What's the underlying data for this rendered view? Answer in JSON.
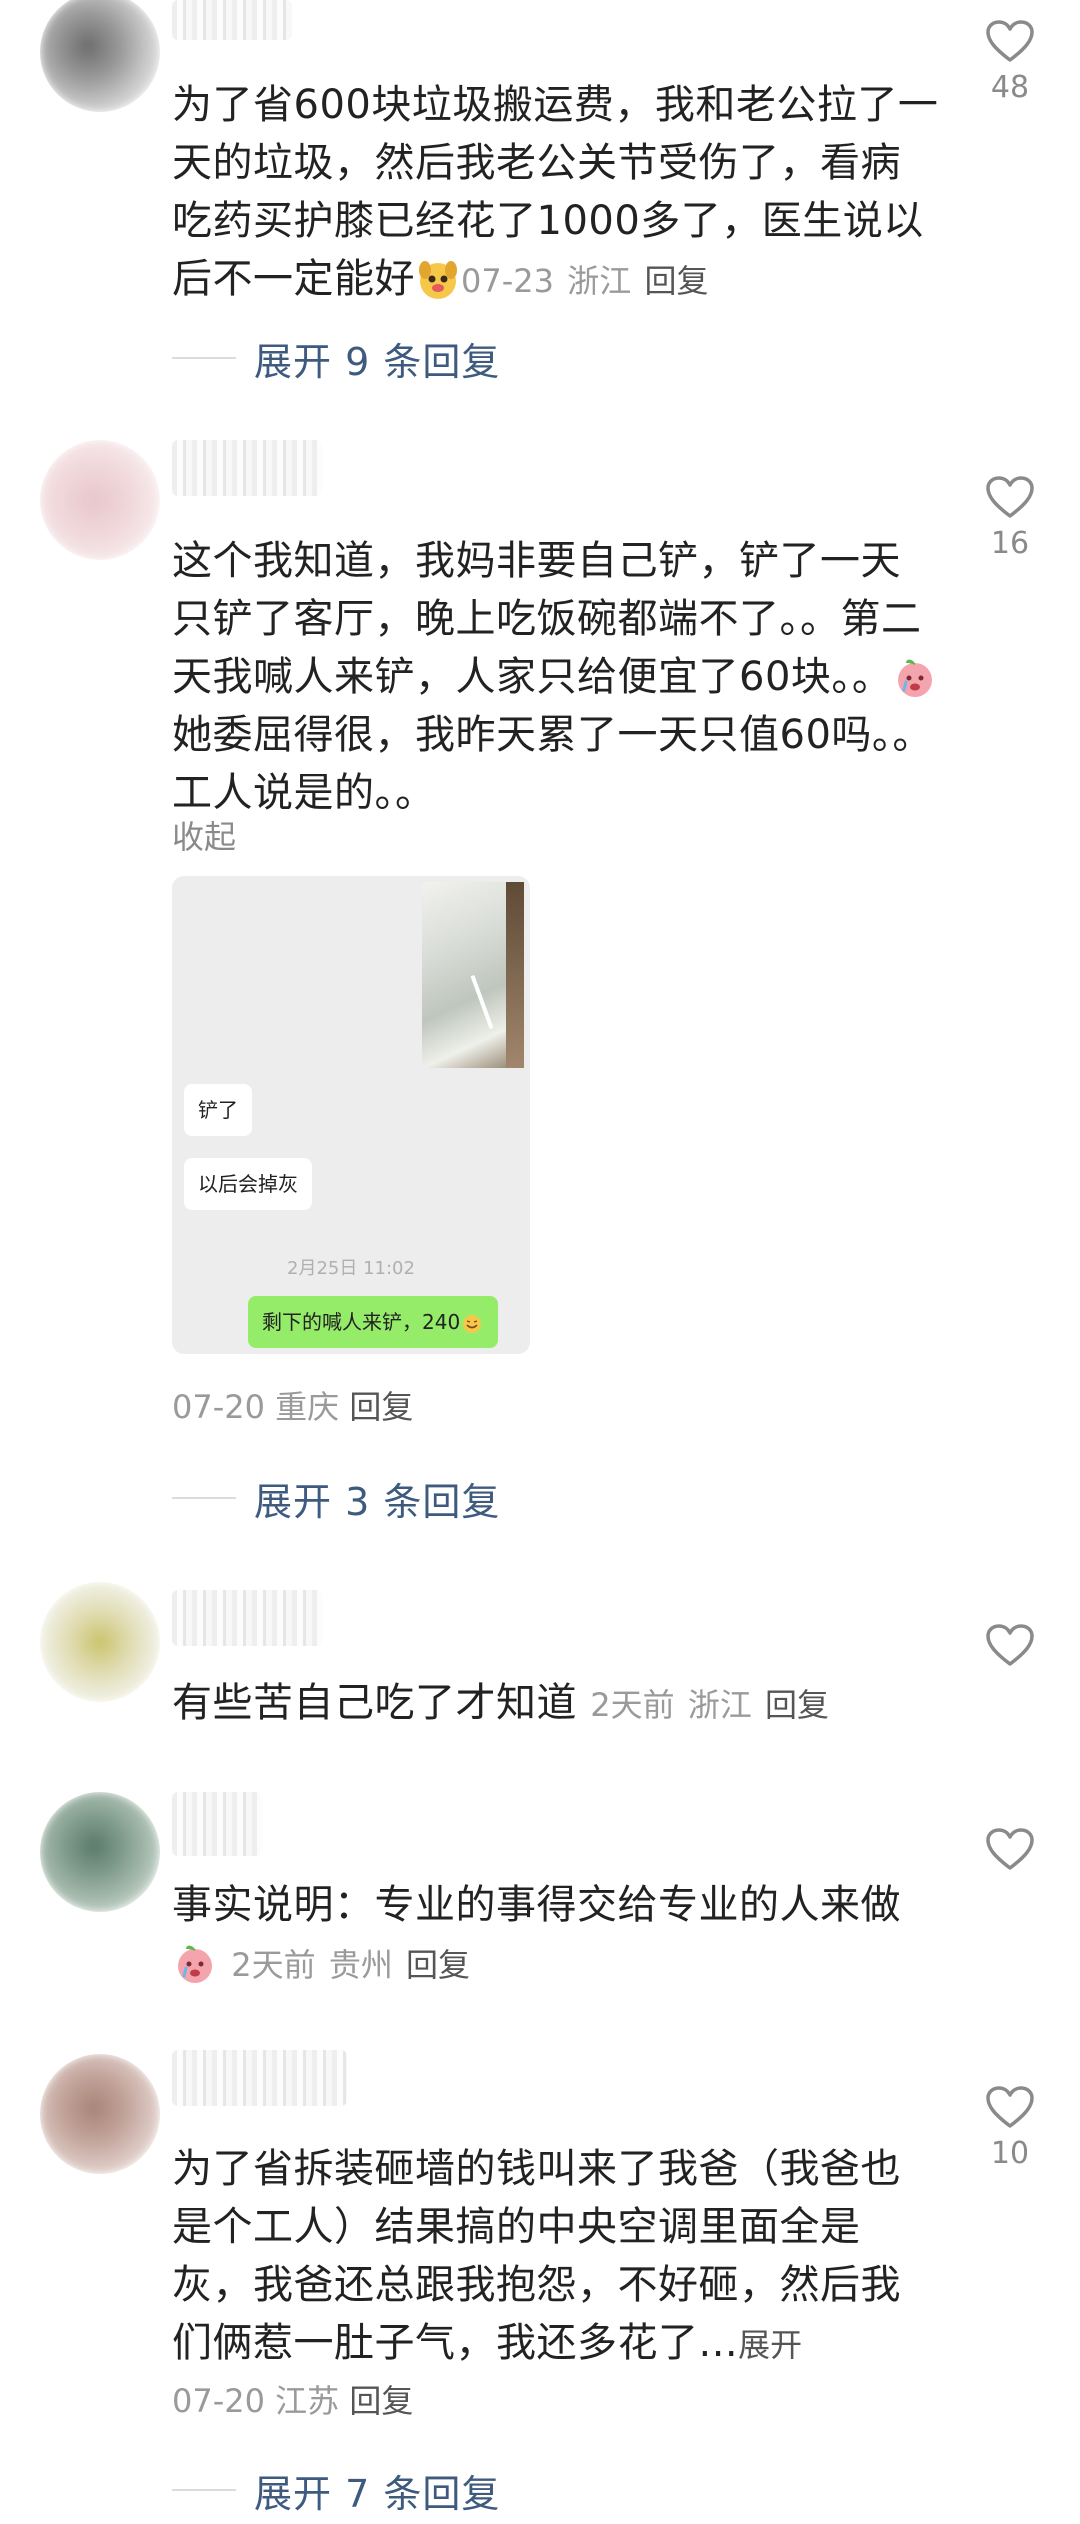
{
  "comments": [
    {
      "text": "为了省600块垃圾搬运费，我和老公拉了一天的垃圾，然后我老公关节受伤了，看病吃药买护膝已经花了1000多了，医生说以后不一定能好",
      "emoji": "dog-face",
      "date": "07-23",
      "location": "浙江",
      "reply_label": "回复",
      "likes": "48",
      "expand_label": "展开 9 条回复"
    },
    {
      "text": "这个我知道，我妈非要自己铲，铲了一天只铲了客厅，晚上吃饭碗都端不了。。第二天我喊人来铲，人家只给便宜了60块。。",
      "emoji": "peach-crying-face",
      "text_after": "她委屈得很，我昨天累了一天只值60吗。。工人说是的。。",
      "fold_label": "收起",
      "date": "07-20",
      "location": "重庆",
      "reply_label": "回复",
      "likes": "16",
      "expand_label": "展开 3 条回复",
      "attachment": {
        "bubble_1": "铲了",
        "bubble_2": "以后会掉灰",
        "time": "2月25日 11:02",
        "bubble_3": "剩下的喊人来铲，240"
      }
    },
    {
      "text": "有些苦自己吃了才知道",
      "date": "2天前",
      "location": "浙江",
      "reply_label": "回复"
    },
    {
      "text": "事实说明：专业的事得交给专业的人来做",
      "emoji": "peach-crying-face",
      "date": "2天前",
      "location": "贵州",
      "reply_label": "回复"
    },
    {
      "text": "为了省拆装砸墙的钱叫来了我爸（我爸也是个工人）结果搞的中央空调里面全是灰，我爸还总跟我抱怨，不好砸，然后我们俩惹一肚子气，我还多花了...",
      "more_label": "展开",
      "date": "07-20",
      "location": "江苏",
      "reply_label": "回复",
      "likes": "10",
      "expand_label": "展开 7 条回复"
    }
  ],
  "colors": {
    "text": "#222222",
    "meta": "#9a9a9a",
    "expand_link": "#3e5a7e",
    "chat_green": "#95ec69"
  }
}
